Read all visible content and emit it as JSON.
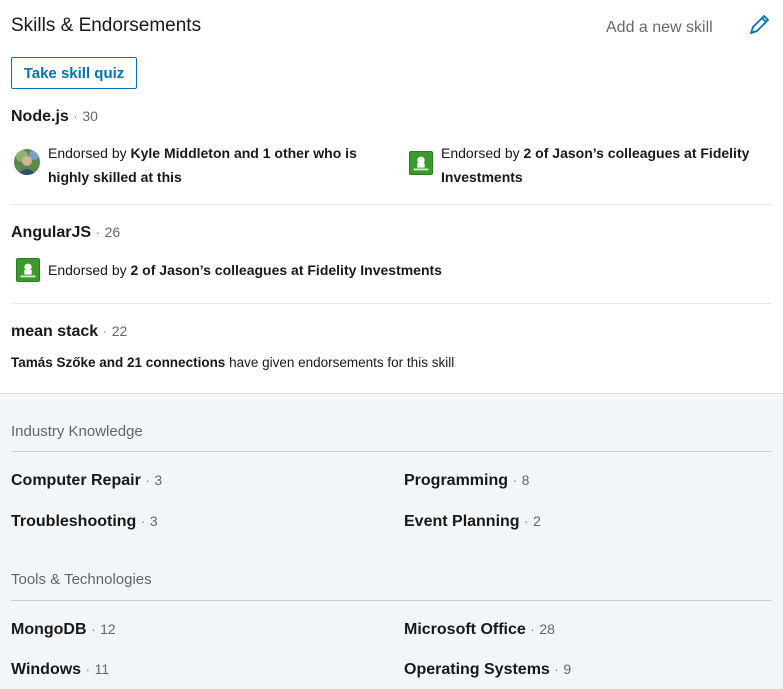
{
  "header": {
    "title": "Skills & Endorsements",
    "add_skill": "Add a new skill",
    "quiz_button": "Take skill quiz"
  },
  "top_skills": [
    {
      "name": "Node.js",
      "count": "30",
      "endorsements": [
        {
          "prefix": "Endorsed by ",
          "bold": "Kyle Middleton and 1 other who is",
          "line2": "highly skilled at this"
        },
        {
          "prefix": "Endorsed by ",
          "bold": "2 of Jason’s colleagues at Fidelity",
          "line2": "Investments"
        }
      ]
    },
    {
      "name": "AngularJS",
      "count": "26",
      "endorsements": [
        {
          "prefix": "Endorsed by ",
          "bold": "2 of Jason’s colleagues at Fidelity Investments"
        }
      ]
    },
    {
      "name": "mean stack",
      "count": "22",
      "endorsements": [
        {
          "bold": "Tamás Szőke and 21 connections",
          "suffix": " have given endorsements for this skill"
        }
      ]
    }
  ],
  "separator": "·",
  "industry_knowledge": {
    "title": "Industry Knowledge",
    "skills": [
      {
        "name": "Computer Repair",
        "count": "3"
      },
      {
        "name": "Programming",
        "count": "8"
      },
      {
        "name": "Troubleshooting",
        "count": "3"
      },
      {
        "name": "Event Planning",
        "count": "2"
      }
    ]
  },
  "tools_technologies": {
    "title": "Tools & Technologies",
    "skills": [
      {
        "name": "MongoDB",
        "count": "12"
      },
      {
        "name": "Microsoft Office",
        "count": "28"
      },
      {
        "name": "Windows",
        "count": "11"
      },
      {
        "name": "Operating Systems",
        "count": "9"
      }
    ]
  },
  "colors": {
    "accent": "#0073b1",
    "fidelity_green": "#3c9a2c",
    "bottom_bg": "#f3f6f8"
  }
}
